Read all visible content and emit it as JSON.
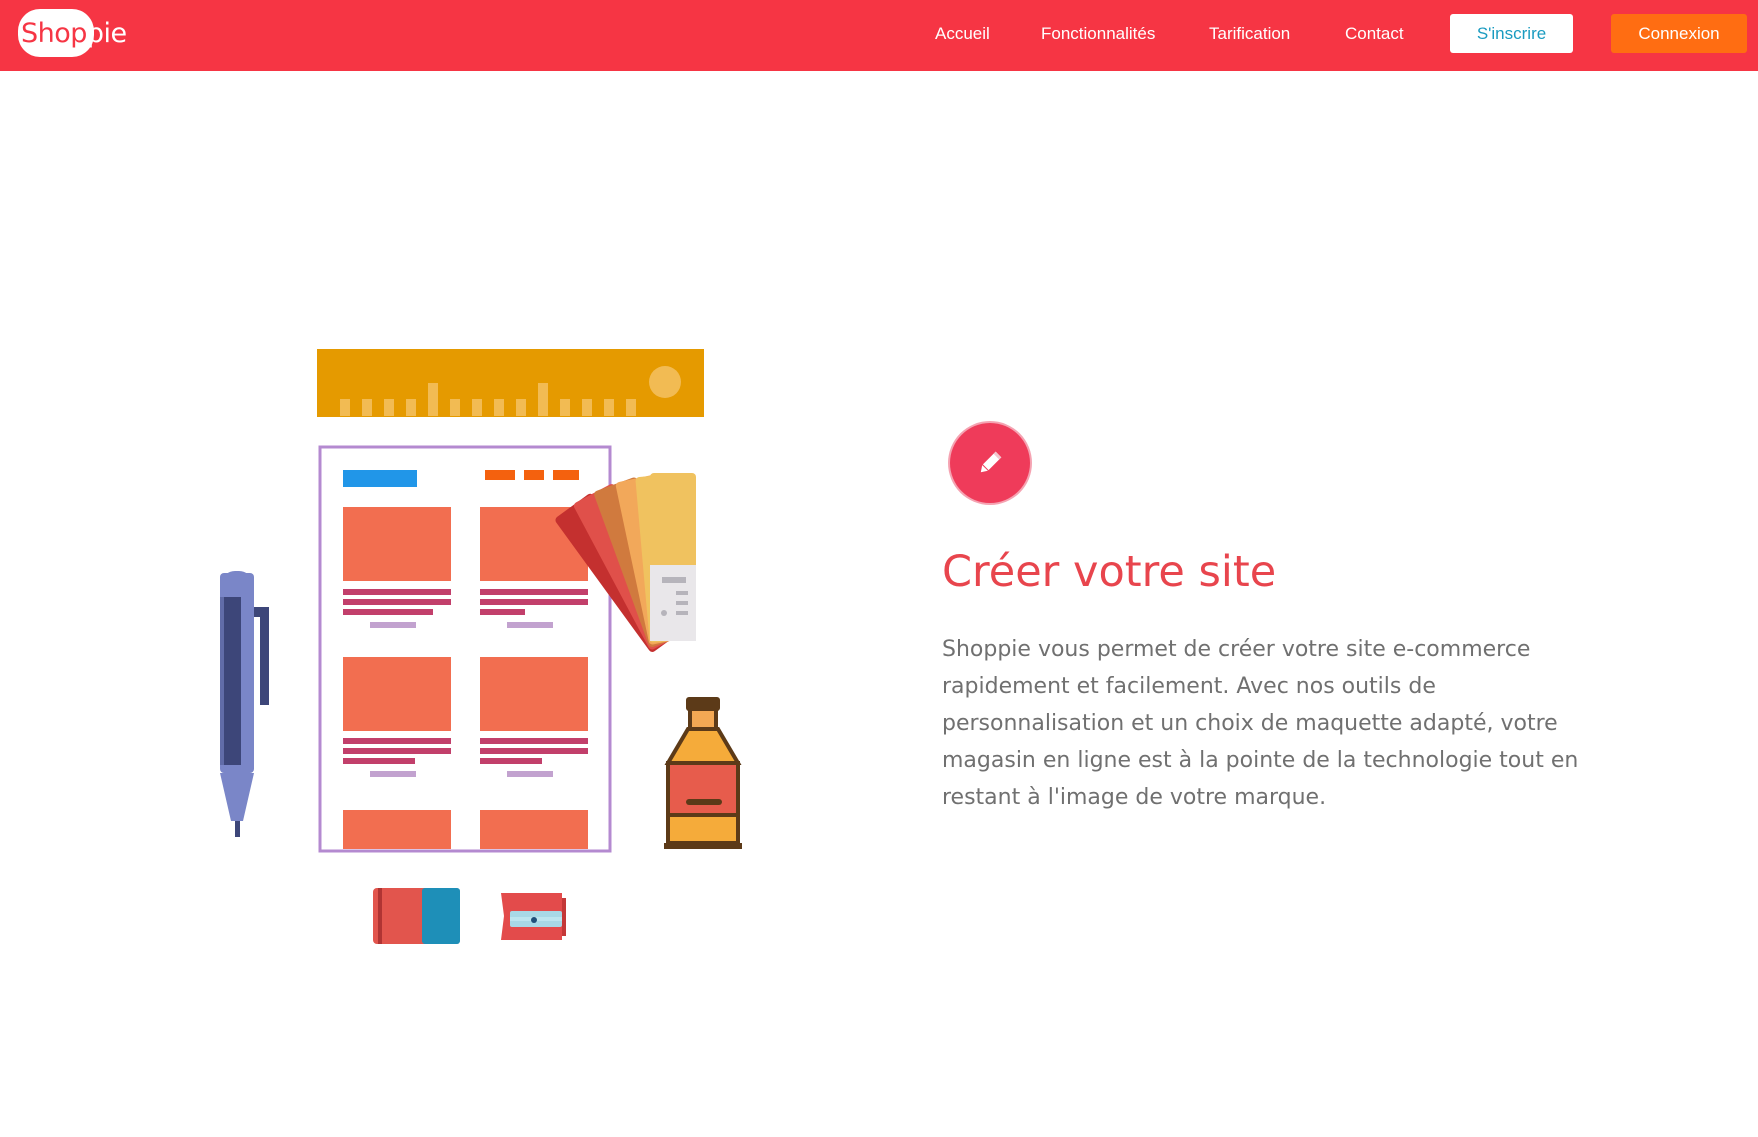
{
  "brand": {
    "logo_part1": "Shop",
    "logo_part2": "pie",
    "color": "#f63544"
  },
  "nav": {
    "links": [
      "Accueil",
      "Fonctionnalités",
      "Tarification",
      "Contact"
    ],
    "signup_label": "S'inscrire",
    "login_label": "Connexion",
    "signup_text_color": "#1a9bc0",
    "login_bg_color": "#ff6d12"
  },
  "feature": {
    "icon": "pencil-icon",
    "title": "Créer votre site",
    "description": "Shoppie vous permet de créer votre site e-commerce rapidement et facilement. Avec nos outils de personnalisation et un choix de maquette adapté, votre magasin en ligne est à la pointe de la technologie tout en restant à l'image de votre marque.",
    "accent_color": "#e8454d"
  },
  "illustration": {
    "items": [
      "ruler",
      "website-mockup",
      "pen",
      "color-swatches",
      "paint-tube",
      "eraser",
      "pencil-sharpener"
    ]
  }
}
